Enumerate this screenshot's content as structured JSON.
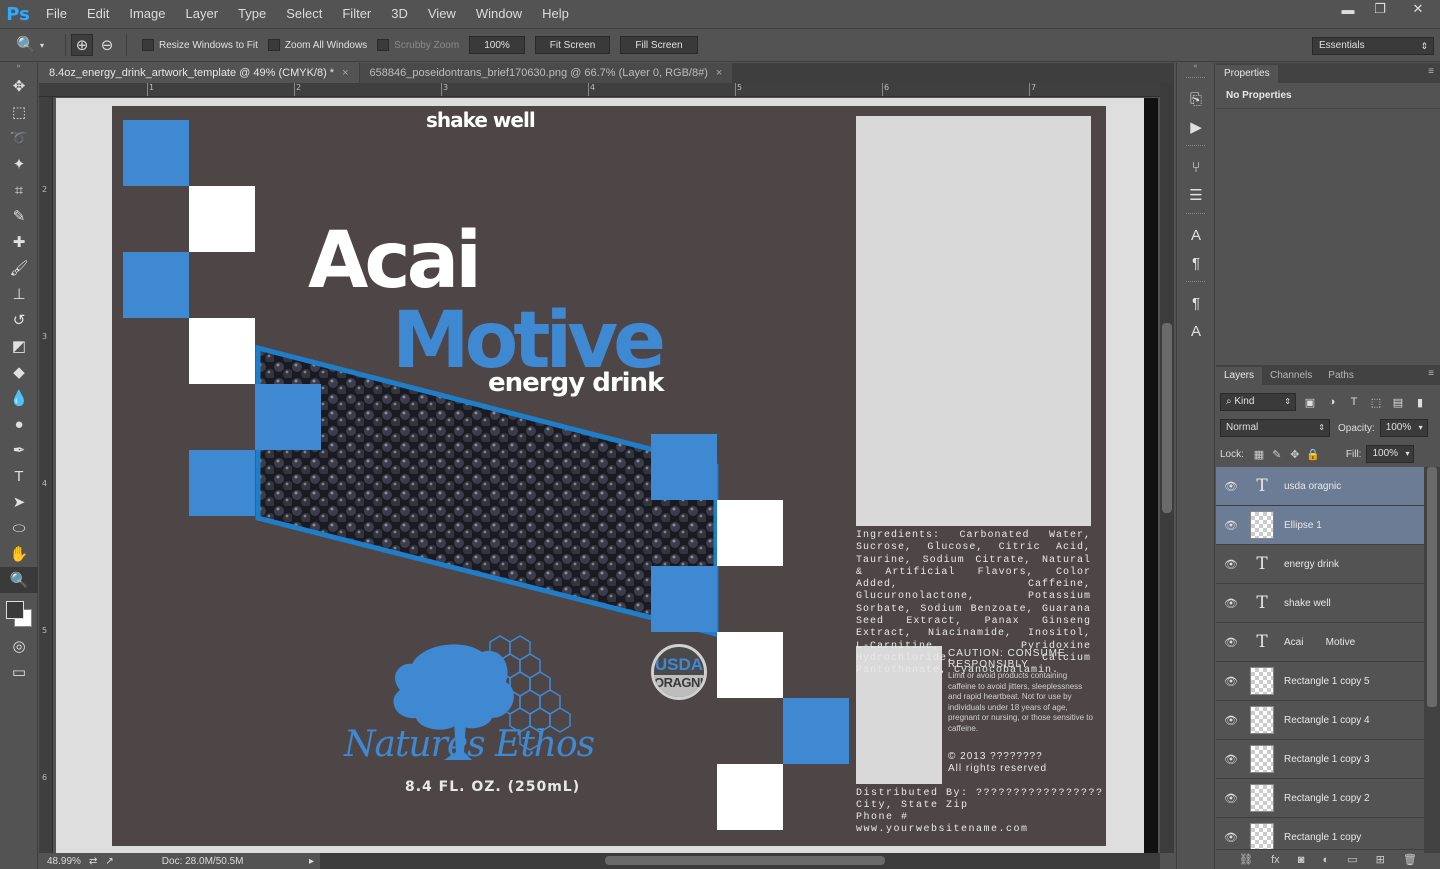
{
  "app": {
    "logo": "Ps"
  },
  "menu": [
    "File",
    "Edit",
    "Image",
    "Layer",
    "Type",
    "Select",
    "Filter",
    "3D",
    "View",
    "Window",
    "Help"
  ],
  "window_controls": {
    "minimize": "▬",
    "restore": "❐",
    "close": "✕"
  },
  "options_bar": {
    "tool_icon": "magnifier-icon",
    "zoom_in_icon": "zoom-in-icon",
    "zoom_out_icon": "zoom-out-icon",
    "resize_windows": "Resize Windows to Fit",
    "zoom_all": "Zoom All Windows",
    "scrubby_zoom": "Scrubby Zoom",
    "btn_100": "100%",
    "btn_fit": "Fit Screen",
    "btn_fill": "Fill Screen",
    "workspace": "Essentials"
  },
  "tabs": [
    {
      "label": "8.4oz_energy_drink_artwork_template @ 49% (CMYK/8) *",
      "active": true
    },
    {
      "label": "658846_poseidontrans_brief170630.png @ 66.7% (Layer 0, RGB/8#)",
      "active": false
    }
  ],
  "ruler": {
    "top_numbers": [
      "1",
      "2",
      "3",
      "4",
      "5",
      "6",
      "7"
    ],
    "left_numbers": [
      "2",
      "3",
      "4",
      "5",
      "6"
    ]
  },
  "artwork": {
    "shake": "shake well",
    "acai": "Acai",
    "motive": "Motive",
    "energy": "energy drink",
    "volume": "8.4 FL. OZ. (250mL)",
    "usda_top": "USDA",
    "usda_bottom": "ORAGNIC",
    "brand": "Natures Ethos",
    "ingredients": "Ingredients: Carbonated Water, Sucrose, Glucose, Citric Acid, Taurine, Sodium Citrate, Natural & Artificial Flavors, Color Added, Caffeine, Glucuronolactone, Potassium Sorbate, Sodium Benzoate, Guarana Seed Extract, Panax Ginseng Extract, Niacinamide, Inositol, L-Carnitine, Pyridoxine Hydrochloride, Calcium Pantothenate, Cyanocobalamin.",
    "caution_title": "CAUTION: CONSUME RESPONSIBLY",
    "caution_body": "Limit or avoid products containing caffeine to avoid jitters, sleeplessness and rapid heartbeat. Not for use by individuals under 18 years of age, pregnant or nursing, or those sensitive to caffeine.",
    "copyright_line1": "© 2013 ????????",
    "copyright_line2": "All rights reserved",
    "distributed": "Distributed By: ?????????????????",
    "city": "City, State Zip",
    "phone": "Phone #",
    "website": "www.yourwebsitename.com",
    "blue": "#3f88d2"
  },
  "statusbar": {
    "zoom": "48.99%",
    "doc": "Doc: 28.0M/50.5M"
  },
  "properties": {
    "tab": "Properties",
    "text": "No Properties"
  },
  "layers_panel": {
    "tabs": [
      "Layers",
      "Channels",
      "Paths"
    ],
    "kind": "Kind",
    "blend": "Normal",
    "opacity_label": "Opacity:",
    "opacity": "100%",
    "lock_label": "Lock:",
    "fill_label": "Fill:",
    "fill": "100%",
    "layers": [
      {
        "name": "usda oragnic",
        "type": "text",
        "selected": true
      },
      {
        "name": "Ellipse 1",
        "type": "raster",
        "selected": true
      },
      {
        "name": "energy drink",
        "type": "text",
        "selected": false
      },
      {
        "name": "shake well",
        "type": "text",
        "selected": false
      },
      {
        "name": "Acai        Motive",
        "type": "text",
        "selected": false
      },
      {
        "name": "Rectangle 1 copy 5",
        "type": "raster",
        "selected": false
      },
      {
        "name": "Rectangle 1 copy 4",
        "type": "raster",
        "selected": false
      },
      {
        "name": "Rectangle 1 copy 3",
        "type": "raster",
        "selected": false
      },
      {
        "name": "Rectangle 1 copy 2",
        "type": "raster",
        "selected": false
      },
      {
        "name": "Rectangle 1 copy",
        "type": "raster",
        "selected": false
      }
    ]
  }
}
